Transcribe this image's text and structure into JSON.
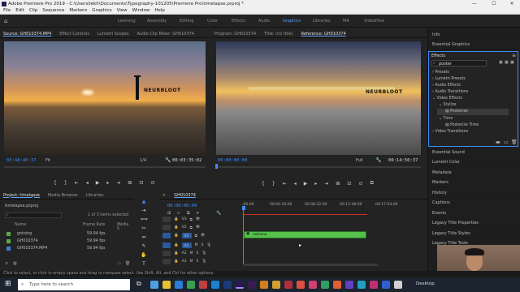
{
  "window": {
    "title": "Adobe Premiere Pro 2019 - C:\\Users\\lekh\\Documents\\Typography-101205\\Premiere Pro\\timelapse.prproj *",
    "min": "—",
    "max": "☐",
    "close": "✕"
  },
  "menu": [
    "File",
    "Edit",
    "Clip",
    "Sequence",
    "Markers",
    "Graphics",
    "View",
    "Window",
    "Help"
  ],
  "workspaces": [
    "Learning",
    "Assembly",
    "Editing",
    "Color",
    "Effects",
    "Audio",
    "Graphics",
    "Libraries",
    "MA",
    "VideoHive"
  ],
  "workspace_active": "Graphics",
  "source_panel": {
    "tabs": [
      "Source: GH010374.MP4",
      "Effect Controls",
      "Lumetri Scopes",
      "Audio Clip Mixer: GH010374"
    ],
    "timecode": "03:48:40:37",
    "fit": "Fit",
    "ratio": "1/4",
    "duration": "00:03:35:02",
    "watermark": "NEURBLOOT"
  },
  "program_panel": {
    "tabs": [
      "Program: GH010374",
      "Title: (no title)",
      "Reference: GH010374"
    ],
    "timecode": "00:00:00:00",
    "fit": "Full",
    "duration": "00:14:50:37",
    "watermark": "NEURBLOOT"
  },
  "right_panel": {
    "top_items": [
      "Info",
      "Essential Graphics"
    ],
    "effects_title": "Effects",
    "search_value": "poster",
    "tree": [
      "Presets",
      "Lumetri Presets",
      "Audio Effects",
      "Audio Transitions",
      "Video Effects",
      "Stylize",
      "Posterize",
      "Time",
      "Posterize Time",
      "Video Transitions"
    ],
    "bottom_items": [
      "Essential Sound",
      "Lumetri Color",
      "Metadata",
      "Markers",
      "History",
      "Captions",
      "Events",
      "Legacy Title Properties",
      "Legacy Title Styles",
      "Legacy Title Tools"
    ]
  },
  "project_panel": {
    "tabs": [
      "Project: timelapse",
      "Media Browser",
      "Libraries"
    ],
    "file": "timelapse.prproj",
    "selected_info": "1 of 3 items selected",
    "columns": [
      "Name",
      "Frame Rate",
      "Media S"
    ],
    "items": [
      {
        "name": "gotoing",
        "rate": "59.94 fps",
        "color": "#5ba84a"
      },
      {
        "name": "GH010374",
        "rate": "59.94 fps",
        "color": "#5ba84a"
      },
      {
        "name": "GH010374.MP4",
        "rate": "59.94 fps",
        "color": "#3e7fd1"
      }
    ]
  },
  "timeline": {
    "tab": "GH010374",
    "timecode": "00:00:00:00",
    "ruler": [
      ":00:00",
      "00:04:16:00",
      "00:08:32:00",
      "00:12:48:00",
      "00:17:04:00"
    ],
    "tracks": [
      "V3",
      "V2",
      "V1",
      "A1",
      "A2",
      "A3"
    ],
    "clip_label": "volcano"
  },
  "status_bar": "Click to select, or click in empty space and drag to marquee select. Use Shift, Alt, and Ctrl for other options.",
  "taskbar": {
    "search_placeholder": "Type here to search",
    "desktop": "Desktop"
  }
}
